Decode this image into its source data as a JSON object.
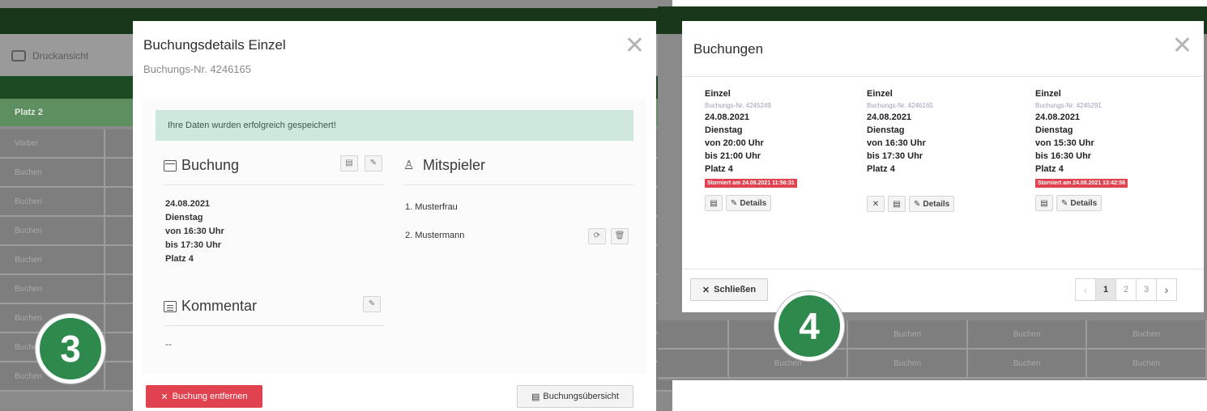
{
  "left_bg": {
    "print_label": "Druckansicht",
    "platz_label": "Platz 2",
    "rows": [
      "Vorbei",
      "Buchen",
      "Buchen",
      "Buchen",
      "Buchen",
      "Buchen",
      "Buchen",
      "Buchen",
      "Buchen"
    ]
  },
  "modal3": {
    "title": "Buchungsdetails Einzel",
    "subtitle": "Buchungs-Nr. 4246165",
    "close_icon": "close-icon",
    "alert": "Ihre Daten wurden erfolgreich gespeichert!",
    "booking_section": {
      "title": "Buchung",
      "icon": "calendar-icon",
      "lines": [
        "24.08.2021",
        "Dienstag",
        "von 16:30 Uhr",
        "bis 17:30 Uhr",
        "Platz 4"
      ]
    },
    "players_section": {
      "title": "Mitspieler",
      "icon": "users-icon",
      "players": [
        "1. Musterfrau",
        "2. Mustermann"
      ]
    },
    "comment_section": {
      "title": "Kommentar",
      "icon": "document-icon",
      "text": "--"
    },
    "remove_label": "Buchung entfernen",
    "overview_label": "Buchungsübersicht"
  },
  "badge3": "3",
  "badge4": "4",
  "right_bg": {
    "cells": [
      "Buchen",
      "Buchen",
      "Buchen",
      "Buchen"
    ]
  },
  "modal4": {
    "title": "Buchungen",
    "bookings": [
      {
        "type": "Einzel",
        "nr": "Buchungs-Nr. 4245249",
        "date": "24.08.2021",
        "day": "Dienstag",
        "from": "von 20:00 Uhr",
        "to": "bis 21:00 Uhr",
        "court": "Platz 4",
        "cancel": "Storniert am 24.08.2021 11:56:31"
      },
      {
        "type": "Einzel",
        "nr": "Buchungs-Nr. 4246165",
        "date": "24.08.2021",
        "day": "Dienstag",
        "from": "von 16:30 Uhr",
        "to": "bis 17:30 Uhr",
        "court": "Platz 4",
        "cancel": ""
      },
      {
        "type": "Einzel",
        "nr": "Buchungs-Nr. 4245291",
        "date": "24.08.2021",
        "day": "Dienstag",
        "from": "von 15:30 Uhr",
        "to": "bis 16:30 Uhr",
        "court": "Platz 4",
        "cancel": "Storniert am 24.08.2021 13:42:56"
      }
    ],
    "details_label": "Details",
    "close_label": "Schließen",
    "pages": [
      "1",
      "2",
      "3"
    ],
    "active_page": "1"
  }
}
